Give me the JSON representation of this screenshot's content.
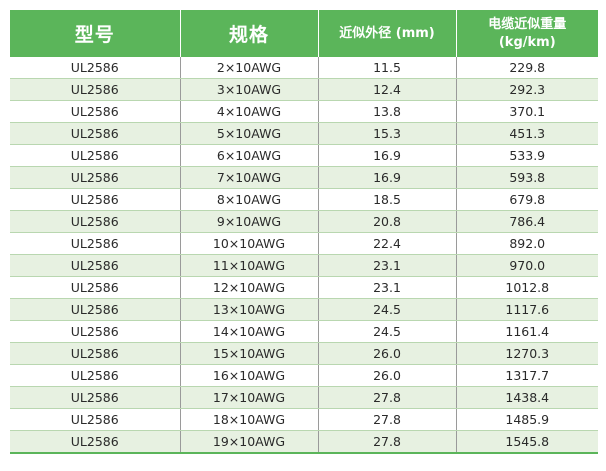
{
  "table": {
    "headers": {
      "model": "型号",
      "spec": "规格",
      "diameter": "近似外径 (mm)",
      "weight_line1": "电缆近似重量",
      "weight_line2": "(kg/km)"
    },
    "rows": [
      {
        "model": "UL2586",
        "spec": "2×10AWG",
        "diameter": "11.5",
        "weight": "229.8"
      },
      {
        "model": "UL2586",
        "spec": "3×10AWG",
        "diameter": "12.4",
        "weight": "292.3"
      },
      {
        "model": "UL2586",
        "spec": "4×10AWG",
        "diameter": "13.8",
        "weight": "370.1"
      },
      {
        "model": "UL2586",
        "spec": "5×10AWG",
        "diameter": "15.3",
        "weight": "451.3"
      },
      {
        "model": "UL2586",
        "spec": "6×10AWG",
        "diameter": "16.9",
        "weight": "533.9"
      },
      {
        "model": "UL2586",
        "spec": "7×10AWG",
        "diameter": "16.9",
        "weight": "593.8"
      },
      {
        "model": "UL2586",
        "spec": "8×10AWG",
        "diameter": "18.5",
        "weight": "679.8"
      },
      {
        "model": "UL2586",
        "spec": "9×10AWG",
        "diameter": "20.8",
        "weight": "786.4"
      },
      {
        "model": "UL2586",
        "spec": "10×10AWG",
        "diameter": "22.4",
        "weight": "892.0"
      },
      {
        "model": "UL2586",
        "spec": "11×10AWG",
        "diameter": "23.1",
        "weight": "970.0"
      },
      {
        "model": "UL2586",
        "spec": "12×10AWG",
        "diameter": "23.1",
        "weight": "1012.8"
      },
      {
        "model": "UL2586",
        "spec": "13×10AWG",
        "diameter": "24.5",
        "weight": "1117.6"
      },
      {
        "model": "UL2586",
        "spec": "14×10AWG",
        "diameter": "24.5",
        "weight": "1161.4"
      },
      {
        "model": "UL2586",
        "spec": "15×10AWG",
        "diameter": "26.0",
        "weight": "1270.3"
      },
      {
        "model": "UL2586",
        "spec": "16×10AWG",
        "diameter": "26.0",
        "weight": "1317.7"
      },
      {
        "model": "UL2586",
        "spec": "17×10AWG",
        "diameter": "27.8",
        "weight": "1438.4"
      },
      {
        "model": "UL2586",
        "spec": "18×10AWG",
        "diameter": "27.8",
        "weight": "1485.9"
      },
      {
        "model": "UL2586",
        "spec": "19×10AWG",
        "diameter": "27.8",
        "weight": "1545.8"
      }
    ]
  },
  "colors": {
    "header_bg": "#5bb55a",
    "row_alt_bg": "#e7f1e1"
  }
}
